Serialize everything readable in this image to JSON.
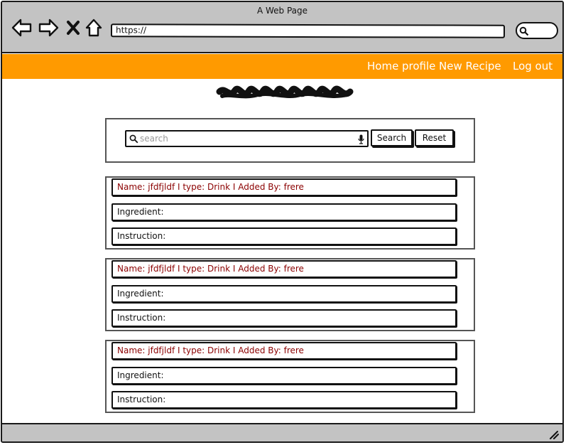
{
  "window": {
    "title": "A Web Page"
  },
  "browser": {
    "url": "https://",
    "icons": [
      "back-arrow-icon",
      "forward-arrow-icon",
      "close-x-icon",
      "home-icon",
      "search-icon"
    ]
  },
  "nav": {
    "items": [
      {
        "label": "Home"
      },
      {
        "label": "profile"
      },
      {
        "label": "New Recipe"
      },
      {
        "label": "Log out"
      }
    ]
  },
  "search": {
    "placeholder": "search",
    "value": "",
    "search_label": "Search",
    "reset_label": "Reset"
  },
  "recipes": [
    {
      "header": "Name: jfdfjldf I type: Drink I Added By: frere",
      "ingredient": "Ingredient:",
      "instruction": "Instruction:"
    },
    {
      "header": "Name: jfdfjldf I type: Drink I Added By: frere",
      "ingredient": "Ingredient:",
      "instruction": "Instruction:"
    },
    {
      "header": "Name: jfdfjldf I type: Drink I Added By: frere",
      "ingredient": "Ingredient:",
      "instruction": "Instruction:"
    }
  ],
  "colors": {
    "menubar": "#ff9a00",
    "chrome": "#c3c3c3",
    "recipe_header_text": "#8b0000",
    "menu_text": "#ffffff"
  }
}
